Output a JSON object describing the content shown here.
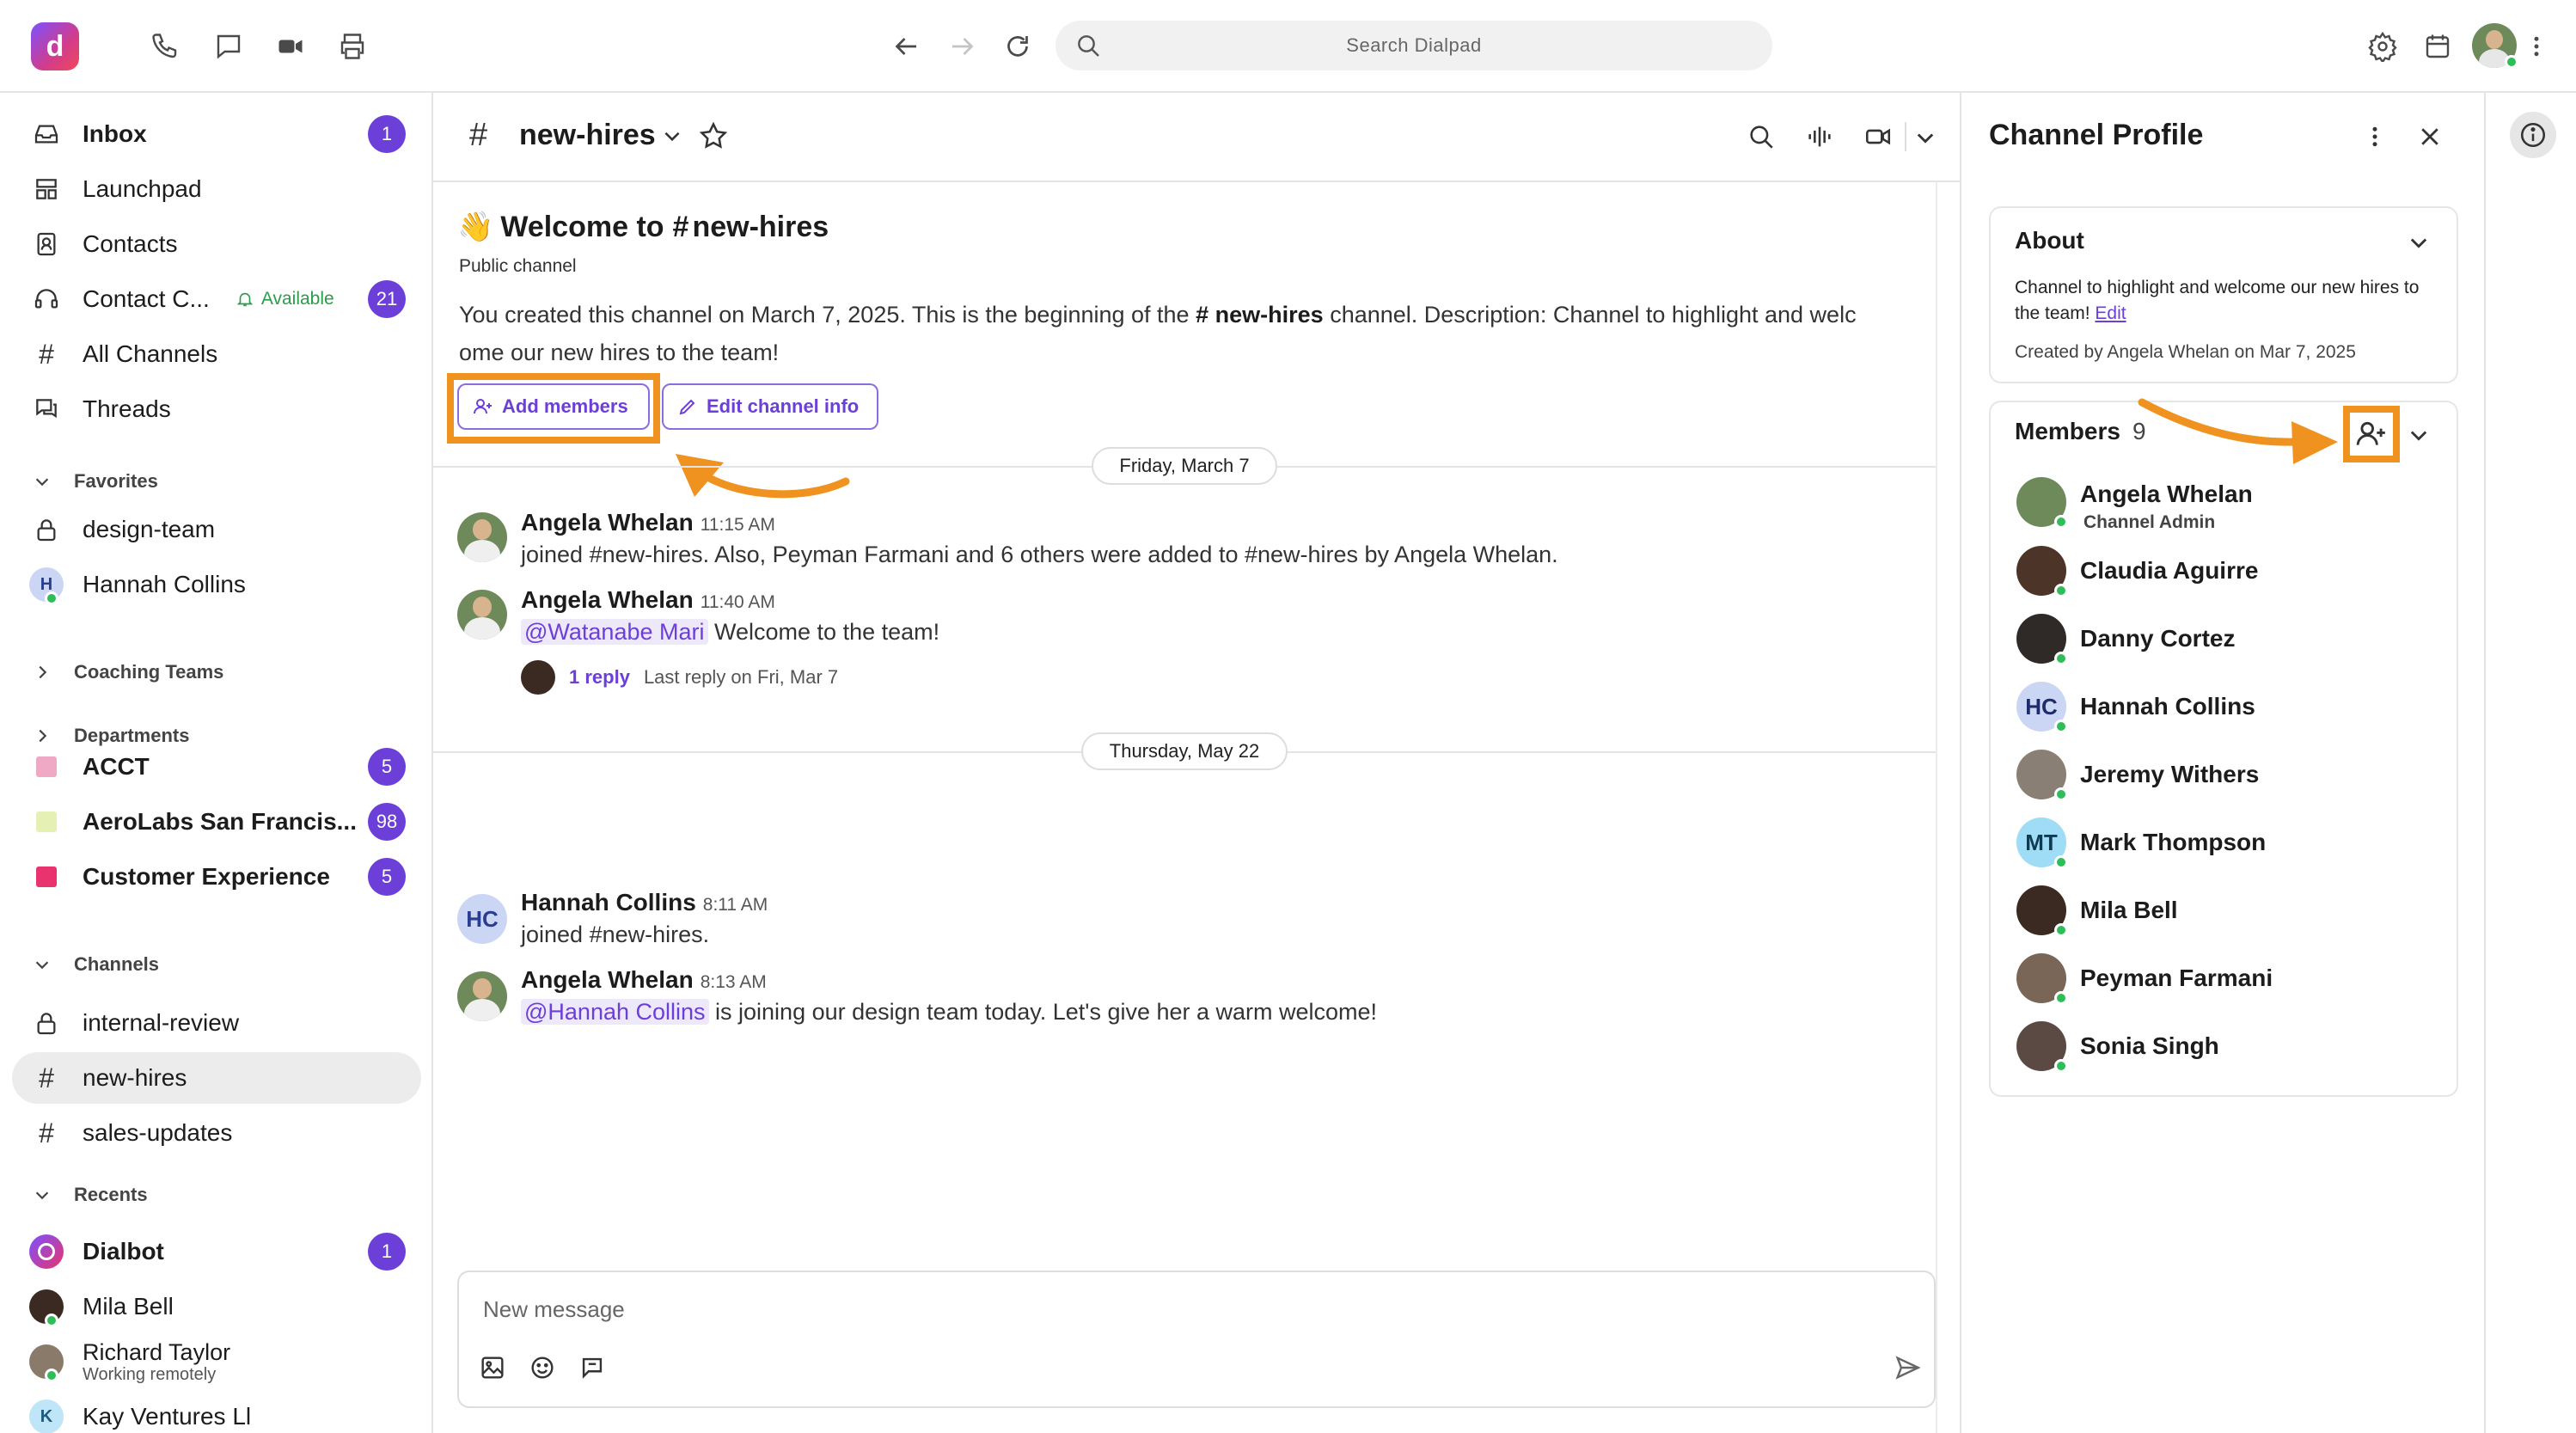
{
  "search": {
    "placeholder": "Search Dialpad"
  },
  "sidebar": {
    "top_items": [
      {
        "label": "Inbox",
        "badge": "1",
        "icon": "inbox-icon"
      },
      {
        "label": "Launchpad",
        "icon": "launchpad-icon"
      },
      {
        "label": "Contacts",
        "icon": "contacts-icon"
      },
      {
        "label": "Contact C...",
        "status": "Available",
        "badge": "21",
        "icon": "headset-icon"
      },
      {
        "label": "All Channels",
        "icon": "hash-icon"
      },
      {
        "label": "Threads",
        "icon": "threads-icon"
      }
    ],
    "favorites": {
      "heading": "Favorites",
      "items": [
        {
          "label": "design-team",
          "icon": "lock-icon"
        },
        {
          "label": "Hannah Collins",
          "initial": "H"
        }
      ]
    },
    "coaching": {
      "heading": "Coaching Teams"
    },
    "departments": {
      "heading": "Departments",
      "items": [
        {
          "label": "ACCT",
          "badge": "5",
          "color": "#f0a9c4"
        },
        {
          "label": "AeroLabs San Francis...",
          "badge": "98",
          "color": "#e5f0b4"
        },
        {
          "label": "Customer Experience",
          "badge": "5",
          "color": "#e8336e"
        }
      ]
    },
    "channels": {
      "heading": "Channels",
      "items": [
        {
          "label": "internal-review",
          "icon": "lock-icon"
        },
        {
          "label": "new-hires",
          "icon": "hash-icon",
          "active": true
        },
        {
          "label": "sales-updates",
          "icon": "hash-icon"
        }
      ]
    },
    "recents": {
      "heading": "Recents",
      "items": [
        {
          "label": "Dialbot",
          "badge": "1"
        },
        {
          "label": "Mila Bell"
        },
        {
          "label": "Richard Taylor",
          "sub": "Working remotely"
        },
        {
          "label": "Kay Ventures Ll",
          "initial": "K"
        }
      ]
    }
  },
  "chat": {
    "channel_name": "new-hires",
    "welcome_emoji": "👋",
    "welcome_title": "Welcome to",
    "welcome_channel": "new-hires",
    "visibility": "Public channel",
    "intro_a": "You created this channel on March 7, 2025. This is the beginning of the",
    "intro_channel": "new-hires",
    "intro_b": "channel. Description: Channel to highlight and welc",
    "intro_c": "ome our new hires to the team!",
    "add_members": "Add members",
    "edit_channel": "Edit channel info",
    "date1": "Friday, March 7",
    "date2": "Thursday, May 22",
    "messages": [
      {
        "name": "Angela Whelan",
        "time": "11:15 AM",
        "body": "joined #new-hires. Also, Peyman Farmani and 6 others were added to #new-hires by Angela Whelan."
      },
      {
        "name": "Angela Whelan",
        "time": "11:40 AM",
        "mention": "@Watanabe Mari",
        "body": "Welcome to the team!",
        "reply_count": "1 reply",
        "reply_meta": "Last reply on Fri, Mar 7"
      },
      {
        "name": "Hannah Collins",
        "time": "8:11 AM",
        "body": "joined #new-hires.",
        "initials": "HC"
      },
      {
        "name": "Angela Whelan",
        "time": "8:13 AM",
        "mention": "@Hannah Collins",
        "body": "is joining our design team today. Let's give her a warm welcome!"
      }
    ],
    "composer_placeholder": "New message"
  },
  "profile": {
    "title": "Channel Profile",
    "about_heading": "About",
    "about_text": "Channel to highlight and welcome our new hires to the team!",
    "about_edit": "Edit",
    "created_by": "Created by Angela Whelan on Mar 7, 2025",
    "members_heading": "Members",
    "members_count": "9",
    "members": [
      {
        "name": "Angela Whelan",
        "role": "Channel Admin"
      },
      {
        "name": "Claudia Aguirre"
      },
      {
        "name": "Danny Cortez"
      },
      {
        "name": "Hannah Collins",
        "initials": "HC"
      },
      {
        "name": "Jeremy Withers"
      },
      {
        "name": "Mark Thompson",
        "initials": "MT"
      },
      {
        "name": "Mila Bell"
      },
      {
        "name": "Peyman Farmani"
      },
      {
        "name": "Sonia Singh"
      }
    ]
  },
  "colors": {
    "accent": "#6b3fd8",
    "highlight": "#f0921f",
    "online": "#2ebd59"
  }
}
